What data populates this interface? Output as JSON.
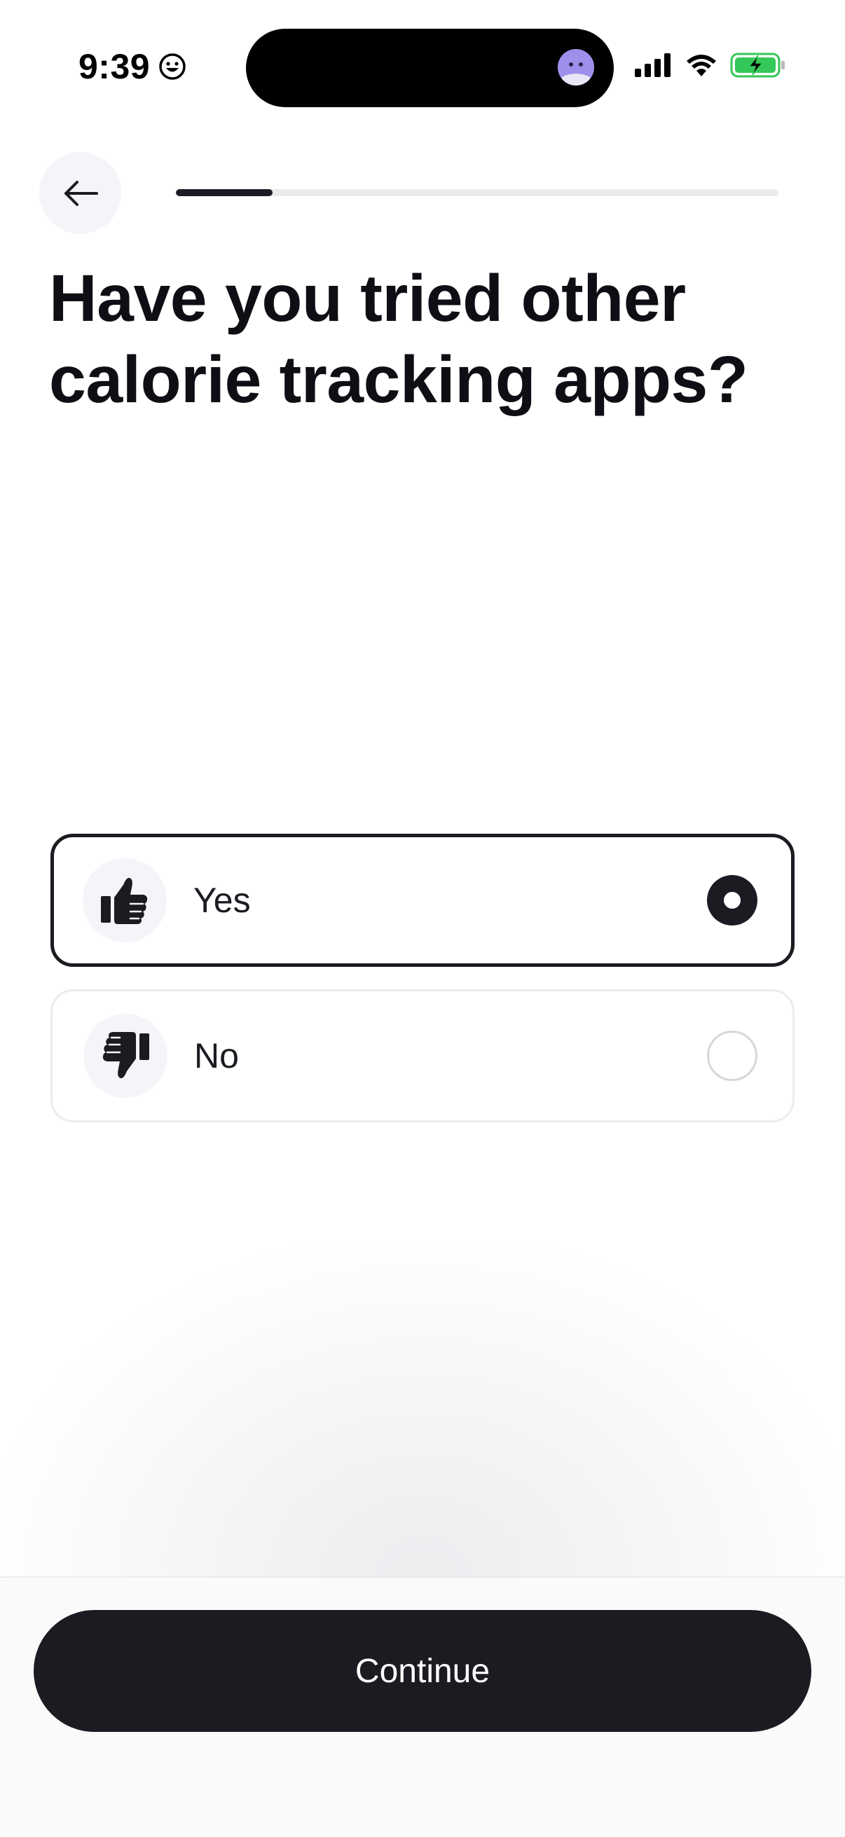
{
  "status_bar": {
    "time": "9:39",
    "icons": [
      "smiley-icon",
      "cellular-signal-icon",
      "wifi-icon",
      "battery-charging-icon"
    ],
    "battery_color": "#34c759"
  },
  "header": {
    "back_icon": "arrow-left-icon",
    "progress": 0.16
  },
  "question": {
    "title": "Have you tried other calorie tracking apps?"
  },
  "options": [
    {
      "label": "Yes",
      "icon": "thumbs-up-icon",
      "selected": true
    },
    {
      "label": "No",
      "icon": "thumbs-down-icon",
      "selected": false
    }
  ],
  "footer": {
    "continue_label": "Continue"
  },
  "colors": {
    "primary": "#1c1b22",
    "option_icon_bg": "#f5f5f9",
    "border_light": "#ececf0"
  }
}
